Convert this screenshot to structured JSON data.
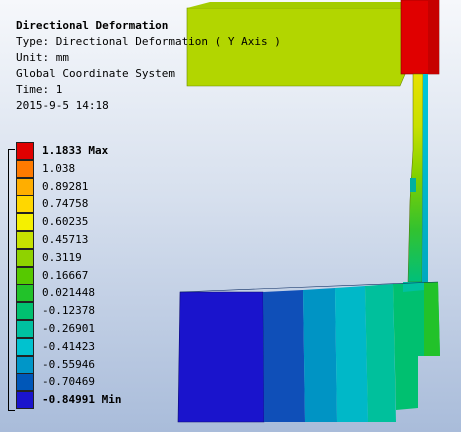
{
  "result": {
    "title": "Directional Deformation",
    "type_line": "Type: Directional Deformation ( Y Axis )",
    "unit_line": "Unit: mm",
    "coordinate_line": "Global Coordinate System",
    "time_line": "Time: 1",
    "date_line": "2015-9-5 14:18"
  },
  "legend": {
    "items": [
      {
        "label": "1.1833 Max",
        "color": "#e00000"
      },
      {
        "label": "1.038",
        "color": "#ff7a00"
      },
      {
        "label": "0.89281",
        "color": "#ffae00"
      },
      {
        "label": "0.74758",
        "color": "#ffd700"
      },
      {
        "label": "0.60235",
        "color": "#f5f000"
      },
      {
        "label": "0.45713",
        "color": "#c6e300"
      },
      {
        "label": "0.3119",
        "color": "#8fd200"
      },
      {
        "label": "0.16667",
        "color": "#56c900"
      },
      {
        "label": "0.021448",
        "color": "#22c22a"
      },
      {
        "label": "-0.12378",
        "color": "#00c070"
      },
      {
        "label": "-0.26901",
        "color": "#00c0a0"
      },
      {
        "label": "-0.41423",
        "color": "#00c2cf"
      },
      {
        "label": "-0.55946",
        "color": "#0096c8"
      },
      {
        "label": "-0.70469",
        "color": "#0057b8"
      },
      {
        "label": "-0.84991 Min",
        "color": "#1a14cc"
      }
    ]
  },
  "colors": {
    "max": "#e00000",
    "upper_plate": "#b3d600",
    "min": "#1a14cc"
  }
}
